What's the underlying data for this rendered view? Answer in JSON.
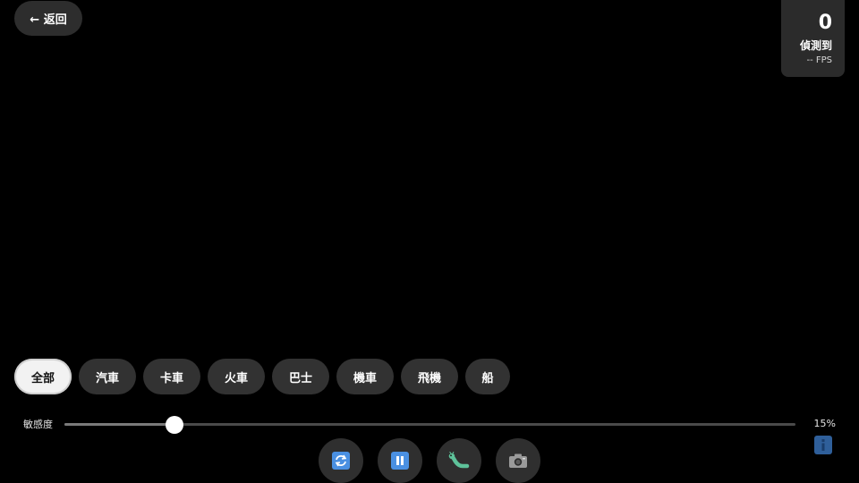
{
  "header": {
    "back_label": "← 返回"
  },
  "stats": {
    "detected_count": "0",
    "detected_label": "偵測到",
    "fps_label": "-- FPS"
  },
  "filters": {
    "items": [
      {
        "label": "全部",
        "active": true
      },
      {
        "label": "汽車",
        "active": false
      },
      {
        "label": "卡車",
        "active": false
      },
      {
        "label": "火車",
        "active": false
      },
      {
        "label": "巴士",
        "active": false
      },
      {
        "label": "機車",
        "active": false
      },
      {
        "label": "飛機",
        "active": false
      },
      {
        "label": "船",
        "active": false
      }
    ]
  },
  "sensitivity": {
    "label": "敏感度",
    "value": 0.15,
    "value_label": "15%"
  },
  "controls": {
    "buttons": [
      {
        "name": "switch-camera-button",
        "icon": "rotate-icon"
      },
      {
        "name": "pause-button",
        "icon": "pause-icon"
      },
      {
        "name": "debug-button",
        "icon": "bug-icon"
      },
      {
        "name": "capture-button",
        "icon": "camera-icon"
      }
    ]
  },
  "info": {
    "icon": "info-icon"
  }
}
